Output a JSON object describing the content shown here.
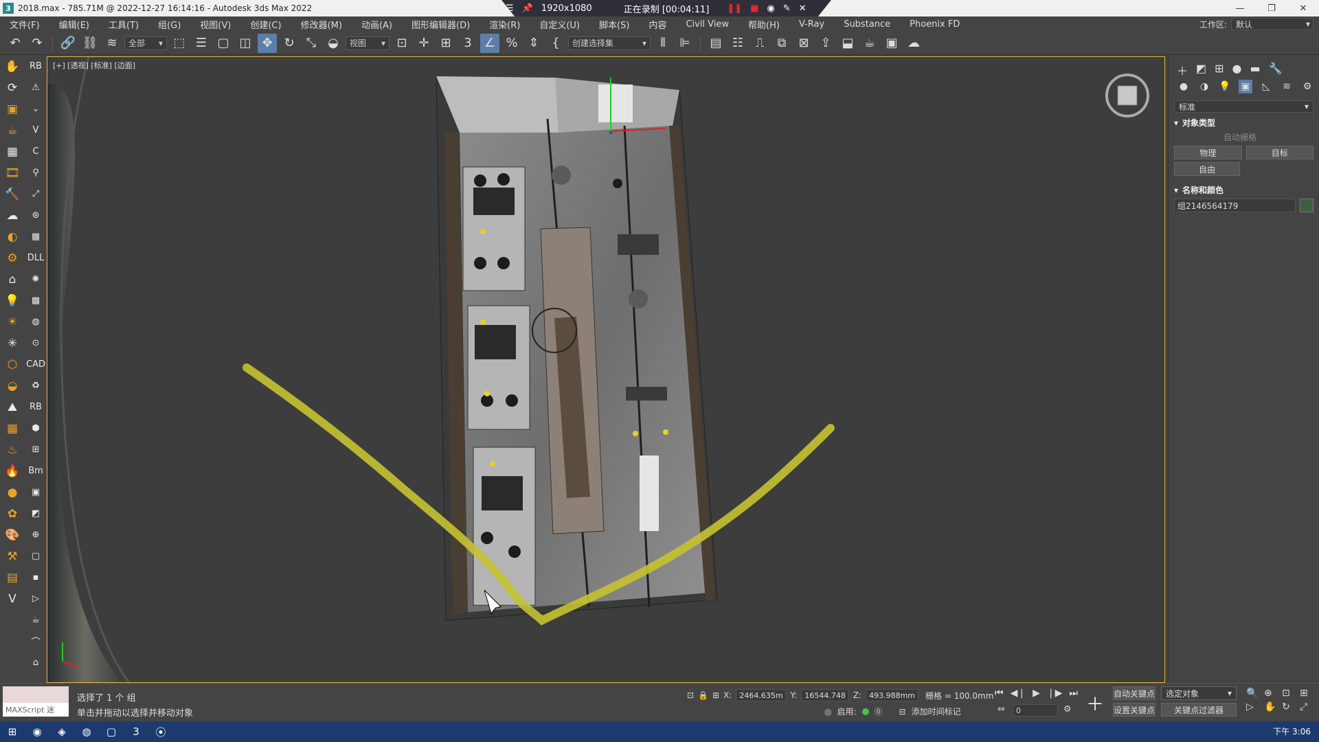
{
  "window": {
    "title": "2018.max - 785.71M @ 2022-12-27 16:14:16 - Autodesk 3ds Max 2022",
    "controls": [
      "—",
      "❐",
      "✕"
    ]
  },
  "recorder": {
    "resolution": "1920x1080",
    "status": "正在录制 [00:04:11]"
  },
  "menu": {
    "items": [
      "文件(F)",
      "编辑(E)",
      "工具(T)",
      "组(G)",
      "视图(V)",
      "创建(C)",
      "修改器(M)",
      "动画(A)",
      "图形编辑器(D)",
      "渲染(R)",
      "自定义(U)",
      "脚本(S)",
      "内容",
      "Civil View",
      "帮助(H)",
      "V-Ray",
      "Substance",
      "Phoenix FD"
    ],
    "workspace_label": "工作区:",
    "workspace_value": "默认"
  },
  "toolbar": {
    "filter_value": "全部",
    "refcoord_value": "视图",
    "selset_value": "创建选择集"
  },
  "left_icons_a": [
    "hand-icon",
    "rotate-icon",
    "box-icon",
    "teapot-icon",
    "camera-icon",
    "film-icon",
    "hammer-icon",
    "cloud-icon",
    "sphere-icon",
    "gear-icon",
    "lamp-icon",
    "bulb-icon",
    "sun-icon",
    "star-icon",
    "cube-icon",
    "ball-icon",
    "terrain-icon",
    "grid-icon",
    "plant-icon",
    "fire-icon",
    "sphere-grey-icon",
    "dots-icon",
    "paint-icon",
    "tool-icon",
    "layer-icon",
    "vray-icon"
  ],
  "left_icons_b": [
    "rb-icon",
    "warning-icon",
    "chevron-down-icon",
    "v-icon",
    "c-icon",
    "pin-icon",
    "link-icon",
    "spin-icon",
    "floor-icon",
    "dll-icon",
    "fan-icon",
    "pattern-icon",
    "globe-icon",
    "zoom-icon",
    "cad-icon",
    "recycle-icon",
    "rb2-icon",
    "hex-icon",
    "plan-icon",
    "bm-icon",
    "image-icon",
    "bucket-icon",
    "target-icon",
    "square-icon",
    "tile-icon",
    "file-icon",
    "teapot2-icon",
    "cap-icon",
    "home-icon"
  ],
  "viewport": {
    "label": "[+] [透视] [标准] [边面]"
  },
  "rightpanel": {
    "dropdown": "标准",
    "section1": "对象类型",
    "checkbox_label": "自动栅格",
    "buttons": [
      "物理",
      "目标",
      "自由"
    ],
    "section2": "名称和颜色",
    "object_name": "组2146564179",
    "object_color": "#3d5f3f"
  },
  "status": {
    "maxscript_label": "MAXScript 迷",
    "line1": "选择了 1 个 组",
    "line2": "单击并拖动以选择并移动对象",
    "x_label": "X:",
    "x_value": "2464.635m",
    "y_label": "Y:",
    "y_value": "16544.748",
    "z_label": "Z:",
    "z_value": "493.988mm",
    "grid_label": "栅格 = 100.0mm",
    "enable_label": "启用:",
    "addtime_label": "添加时间标记",
    "frame_value": "0",
    "autokey_label": "自动关键点",
    "setkey_label": "设置关键点",
    "selobj_value": "选定对象",
    "keyfilter_label": "关键点过滤器"
  },
  "taskbar": {
    "clock": "下午 3:06"
  }
}
